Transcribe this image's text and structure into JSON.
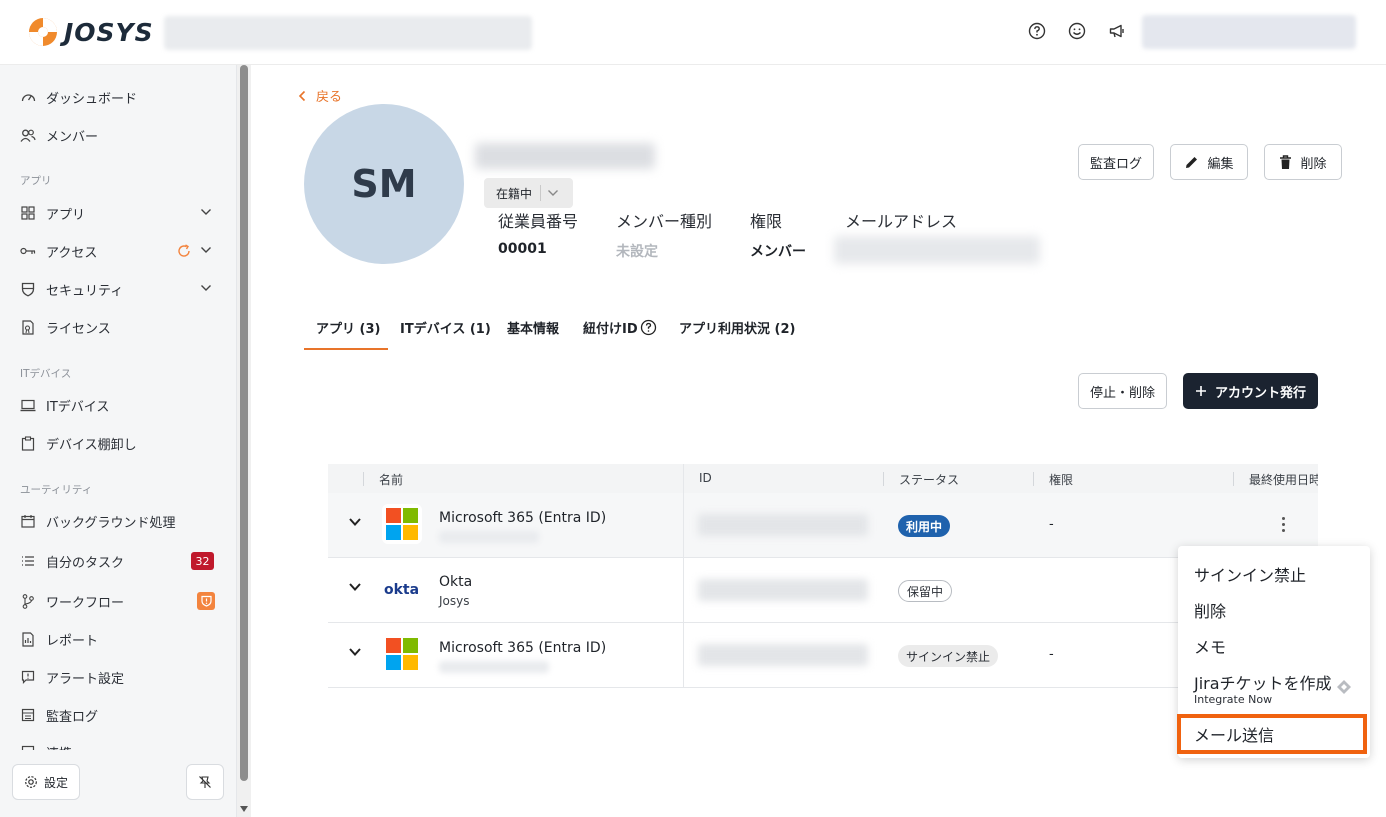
{
  "brand": {
    "name": "JOSYS"
  },
  "sidebar": {
    "items": [
      {
        "label": "ダッシュボード",
        "icon": "gauge-icon"
      },
      {
        "label": "メンバー",
        "icon": "users-icon"
      },
      {
        "label": "アプリ",
        "icon": "grid-icon"
      },
      {
        "label": "アクセス",
        "icon": "key-icon"
      },
      {
        "label": "セキュリティ",
        "icon": "shield-icon"
      },
      {
        "label": "ライセンス",
        "icon": "license-icon"
      },
      {
        "label": "ITデバイス",
        "icon": "laptop-icon"
      },
      {
        "label": "デバイス棚卸し",
        "icon": "clipboard-icon"
      },
      {
        "label": "バックグラウンド処理",
        "icon": "calendar-icon"
      },
      {
        "label": "自分のタスク",
        "icon": "tasks-icon"
      },
      {
        "label": "ワークフロー",
        "icon": "workflow-icon"
      },
      {
        "label": "レポート",
        "icon": "report-icon"
      },
      {
        "label": "アラート設定",
        "icon": "alert-icon"
      },
      {
        "label": "監査ログ",
        "icon": "audit-icon"
      },
      {
        "label": "連携",
        "icon": "link-icon"
      }
    ],
    "sections": {
      "apps": "アプリ",
      "devices": "ITデバイス",
      "utility": "ユーティリティ"
    },
    "task_count": "32",
    "settings_label": "設定"
  },
  "member": {
    "back_label": "戻る",
    "initials": "SM",
    "status": "在籍中",
    "fields": [
      {
        "label": "従業員番号",
        "value": "00001"
      },
      {
        "label": "メンバー種別",
        "value": "未設定"
      },
      {
        "label": "権限",
        "value": "メンバー"
      },
      {
        "label": "メールアドレス",
        "value": ""
      }
    ],
    "actions": {
      "audit": "監査ログ",
      "edit": "編集",
      "delete": "削除"
    }
  },
  "tabs": [
    {
      "label": "アプリ (3)"
    },
    {
      "label": "ITデバイス (1)"
    },
    {
      "label": "基本情報"
    },
    {
      "label": "紐付けID"
    },
    {
      "label": "アプリ利用状況 (2)"
    }
  ],
  "toolbar": {
    "suspend": "停止・削除",
    "issue": "アカウント発行"
  },
  "table": {
    "headers": {
      "name": "名前",
      "id": "ID",
      "status": "ステータス",
      "role": "権限",
      "last_used": "最終使用日時"
    },
    "rows": [
      {
        "app": "Microsoft 365 (Entra ID)",
        "sub": "",
        "status": "利用中",
        "role": "-"
      },
      {
        "app": "Okta",
        "sub": "Josys",
        "status": "保留中",
        "role": ""
      },
      {
        "app": "Microsoft 365 (Entra ID)",
        "sub": "",
        "status": "サインイン禁止",
        "role": "-"
      }
    ]
  },
  "menu": {
    "items": [
      "サインイン禁止",
      "削除",
      "メモ",
      "Jiraチケットを作成",
      "メール送信"
    ],
    "jira_sub": "Integrate Now"
  },
  "colors": {
    "accent": "#e8742a",
    "primary_dark": "#1b2330",
    "badge_red": "#c0192c",
    "status_blue": "#1f62ad"
  }
}
